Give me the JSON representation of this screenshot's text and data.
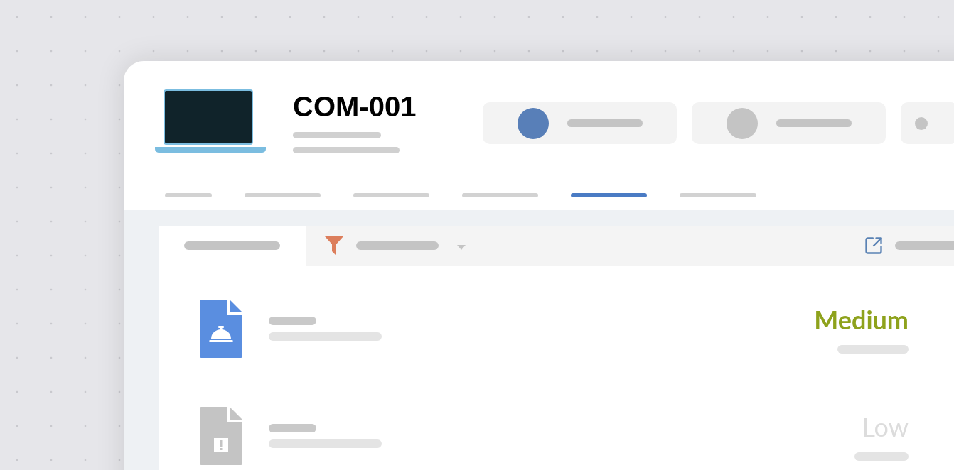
{
  "device": {
    "title": "COM-001"
  },
  "status_pills": [
    {
      "color": "#587fb8"
    },
    {
      "color": "#c4c4c4"
    },
    {
      "color": "#c4c4c4"
    }
  ],
  "tabs": [
    {
      "selected": false
    },
    {
      "selected": false
    },
    {
      "selected": false
    },
    {
      "selected": false
    },
    {
      "selected": true
    },
    {
      "selected": false
    }
  ],
  "items": [
    {
      "kind": "bell",
      "active": true,
      "priority": "Medium",
      "color": "#8ea21c"
    },
    {
      "kind": "alert",
      "active": false,
      "priority": "Low",
      "color": "#dcdcdc"
    }
  ]
}
